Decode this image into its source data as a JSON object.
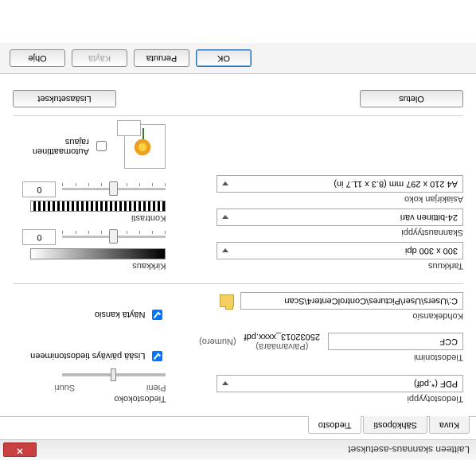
{
  "window": {
    "title": "Laitteen skannaus-asetukset"
  },
  "tabs": {
    "image": "Kuva",
    "email": "Sähköposti",
    "file": "Tiedosto"
  },
  "file": {
    "filetype_label": "Tiedostotyyppi",
    "filetype_value": "PDF (*.pdf)",
    "filename_label": "Tiedostonimi",
    "filename_value": "CCF",
    "date_label": "(Päivämäärä)",
    "number_label": "(Numero)",
    "sample_name": "25032013_xxxx.pdf",
    "destfolder_label": "Kohdekansio",
    "destfolder_value": "C:\\Users\\User\\Pictures\\ControlCenter4\\Scan",
    "insert_date_label": "Lisää päiväys tiedostonimeen",
    "show_folder_label": "Näytä kansio",
    "filesize_label": "Tiedostokoko",
    "filesize_small": "Pieni",
    "filesize_large": "Suuri"
  },
  "scan": {
    "resolution_label": "Tarkkuus",
    "resolution_value": "300 x 300 dpi",
    "scantype_label": "Skannaustyyppi",
    "scantype_value": "24-bittinen väri",
    "docsize_label": "Asiakirjan koko",
    "docsize_value": "A4 210 x 297 mm (8.3 x 11.7 in)",
    "brightness_label": "Kirkkaus",
    "brightness_value": "0",
    "contrast_label": "Kontrasti",
    "contrast_value": "0",
    "autocrop_label": "Automaattinen rajaus"
  },
  "buttons": {
    "default": "Oletus",
    "advanced": "Lisäasetukset",
    "ok": "OK",
    "cancel": "Peruuta",
    "apply": "Käytä",
    "help": "Ohje"
  }
}
